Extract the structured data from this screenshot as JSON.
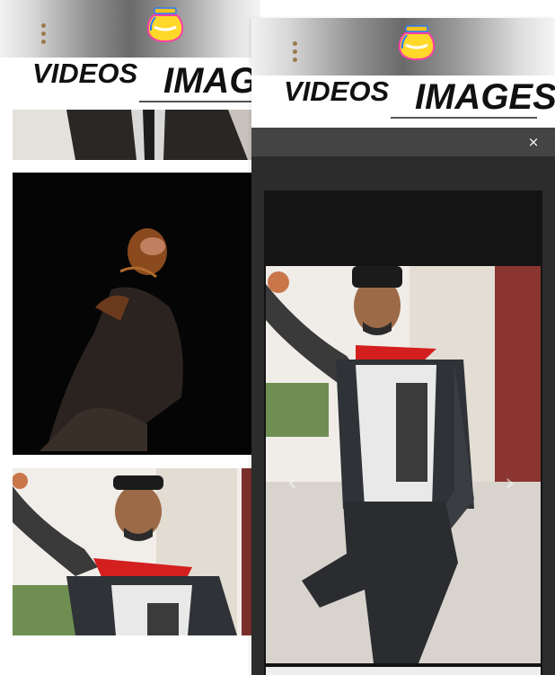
{
  "app": {
    "logo_icon": "jar-logo-icon",
    "menu_icon": "vertical-dots-menu-icon"
  },
  "nav": {
    "videos_label": "VIDEOS",
    "images_label": "IMAGES",
    "active_tab": "images"
  },
  "gallery": {
    "items": [
      {
        "description_icon": "photo-man-in-suit"
      },
      {
        "description_icon": "photo-dark-portrait"
      },
      {
        "description_icon": "photo-man-red-scarf"
      }
    ]
  },
  "lightbox": {
    "close_label": "×",
    "prev_label": "‹",
    "next_label": "›"
  },
  "colors": {
    "header_gradient_mid": "#6a6a6a",
    "menu_dots": "#9a7a4e",
    "lightbox_bg": "#2c2c2c",
    "scarf_red": "#d41f1f"
  }
}
